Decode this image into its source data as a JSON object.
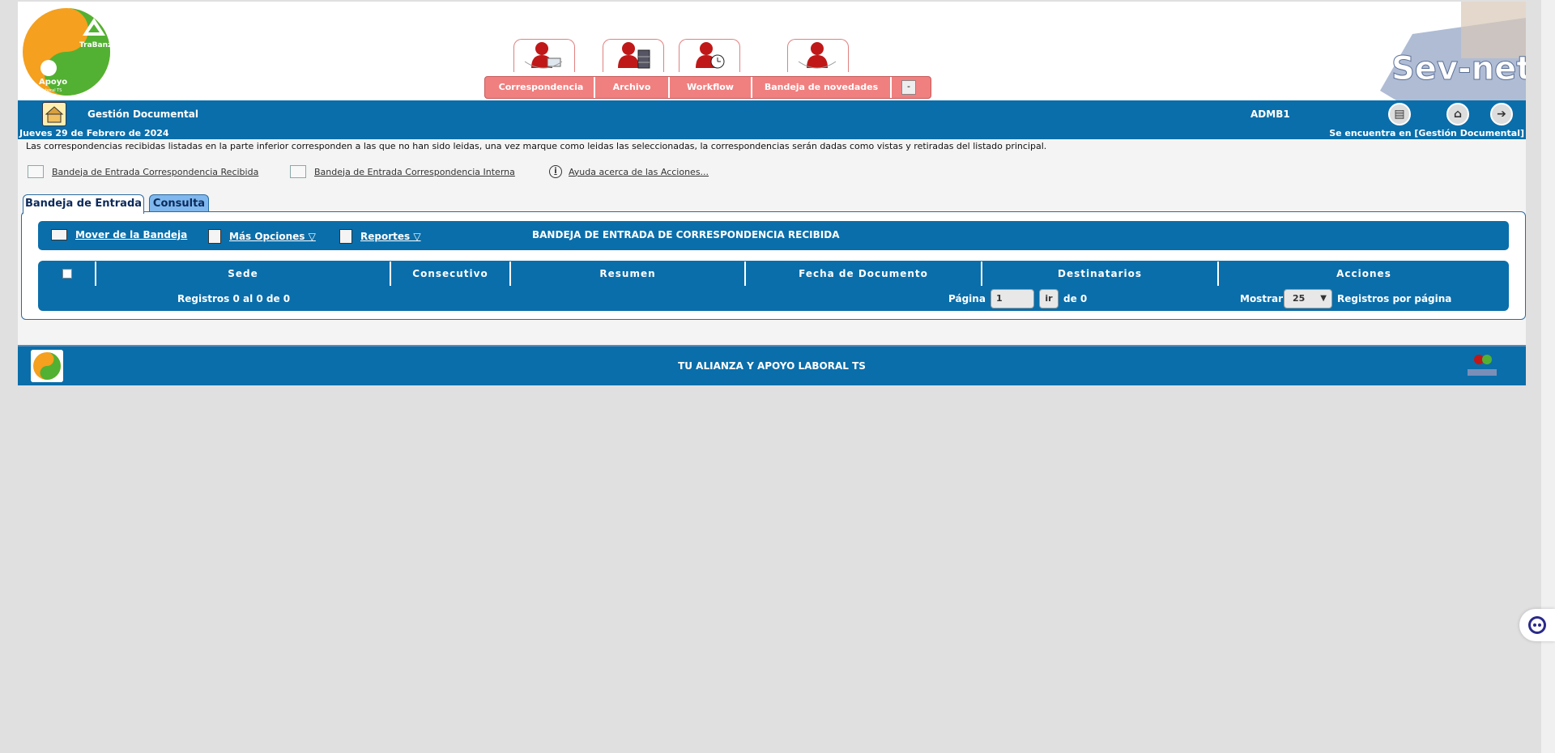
{
  "menu": {
    "items": [
      "Correspondencia",
      "Archivo",
      "Workflow",
      "Bandeja de novedades"
    ],
    "collapse": "-"
  },
  "logo": {
    "text_top": "TraBanza",
    "text_bottom": "Apoyo",
    "text_small": "Laboral TS"
  },
  "brand": {
    "text": "Sev-net"
  },
  "bar": {
    "title": "Gestión Documental",
    "user": "ADMB1"
  },
  "info": {
    "date": "Jueves 29 de Febrero de 2024",
    "location": "Se encuentra en [Gestión Documental]"
  },
  "notice": "Las correspondencias recibidas listadas en la parte inferior corresponden a las que no han sido leidas, una vez marque como leidas las seleccionadas, la correspondencias serán dadas como vistas y retiradas del listado principal.",
  "quick_links": {
    "recibida": "Bandeja de Entrada Correspondencia Recibida",
    "interna": "Bandeja de Entrada Correspondencia Interna",
    "ayuda": " Ayuda acerca de las Acciones..."
  },
  "tabs": {
    "entrada": "Bandeja de Entrada",
    "consulta": "Consulta"
  },
  "toolbar": {
    "mover": "Mover de la Bandeja",
    "opciones": "Más Opciones ▽",
    "reportes": "Reportes ▽",
    "title": "BANDEJA DE ENTRADA DE CORRESPONDENCIA RECIBIDA"
  },
  "table": {
    "columns": [
      "Sede",
      "Consecutivo",
      "Resumen",
      "Fecha de Documento",
      "Destinatarios",
      "Acciones"
    ],
    "registros": "Registros 0 al 0 de 0",
    "pagina_label": "Página",
    "pagina_value": "1",
    "ir": "ir",
    "de": "de 0",
    "mostrar": "Mostrar",
    "per_page": "25",
    "per_page_label": "Registros por página"
  },
  "footer": {
    "text": "TU ALIANZA Y APOYO LABORAL TS"
  },
  "colors": {
    "blue": "#0a6eaa",
    "menu": "#f08080",
    "tab_inactive": "#7fb8ee"
  }
}
